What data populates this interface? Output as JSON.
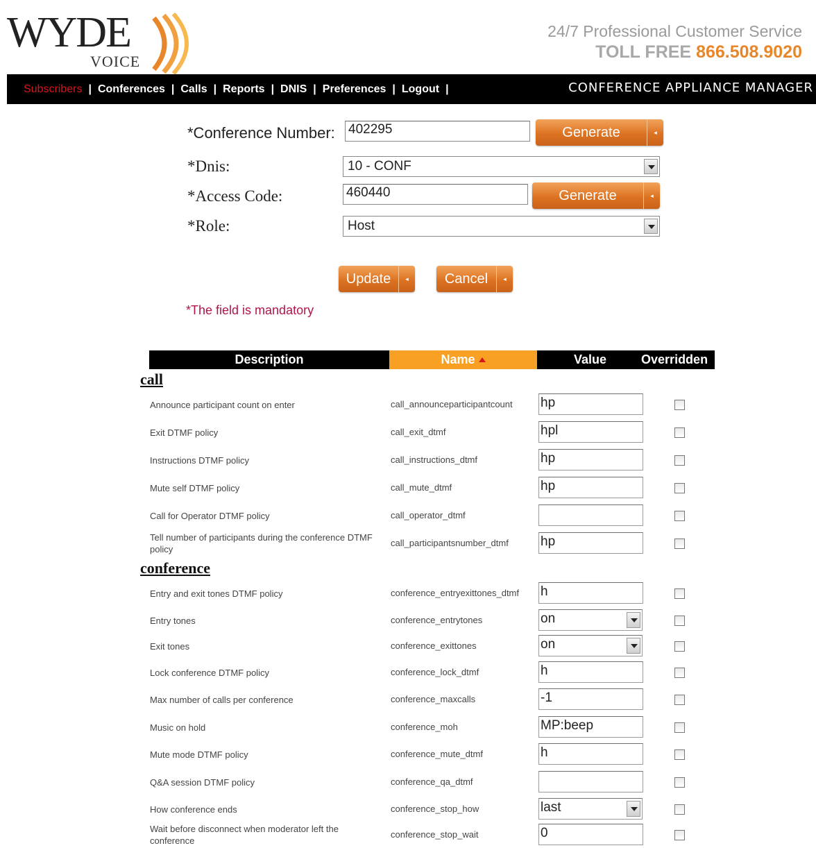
{
  "header": {
    "logo_word": "WYDE",
    "logo_sub": "VOICE",
    "service_line": "24/7 Professional Customer Service",
    "tollfree_label": "TOLL  FREE",
    "phone": "866.508.9020"
  },
  "nav": {
    "items": [
      {
        "label": "Subscribers"
      },
      {
        "label": "Conferences"
      },
      {
        "label": "Calls"
      },
      {
        "label": "Reports"
      },
      {
        "label": "DNIS"
      },
      {
        "label": "Preferences"
      },
      {
        "label": "Logout"
      }
    ],
    "separator": "|",
    "app_title": "CONFERENCE APPLIANCE MANAGER"
  },
  "form": {
    "conference_number": {
      "label": "*Conference Number:",
      "value": "402295"
    },
    "dnis": {
      "label": "*Dnis:",
      "value": "10 - CONF"
    },
    "access_code": {
      "label": "*Access Code:",
      "value": "460440"
    },
    "role": {
      "label": "*Role:",
      "value": "Host"
    },
    "generate_label": "Generate",
    "update_label": "Update",
    "cancel_label": "Cancel",
    "mandatory_note": "*The field is mandatory"
  },
  "table": {
    "headers": {
      "description": "Description",
      "name": "Name",
      "value": "Value",
      "overridden": "Overridden"
    },
    "sections": [
      {
        "title": "call",
        "rows": [
          {
            "desc": "Announce participant count on enter",
            "name": "call_announceparticipantcount",
            "type": "text",
            "value": "hp"
          },
          {
            "desc": "Exit DTMF policy",
            "name": "call_exit_dtmf",
            "type": "text",
            "value": "hpl"
          },
          {
            "desc": "Instructions DTMF policy",
            "name": "call_instructions_dtmf",
            "type": "text",
            "value": "hp"
          },
          {
            "desc": "Mute self DTMF policy",
            "name": "call_mute_dtmf",
            "type": "text",
            "value": "hp"
          },
          {
            "desc": "Call for Operator DTMF policy",
            "name": "call_operator_dtmf",
            "type": "text",
            "value": ""
          },
          {
            "desc": "Tell number of participants during the conference DTMF policy",
            "name": "call_participantsnumber_dtmf",
            "type": "text",
            "value": "hp"
          }
        ]
      },
      {
        "title": "conference",
        "rows": [
          {
            "desc": "Entry and exit tones DTMF policy",
            "name": "conference_entryexittones_dtmf",
            "type": "text",
            "value": "h"
          },
          {
            "desc": "Entry tones",
            "name": "conference_entrytones",
            "type": "select",
            "value": "on"
          },
          {
            "desc": "Exit tones",
            "name": "conference_exittones",
            "type": "select",
            "value": "on"
          },
          {
            "desc": "Lock conference DTMF policy",
            "name": "conference_lock_dtmf",
            "type": "text",
            "value": "h"
          },
          {
            "desc": "Max number of calls per conference",
            "name": "conference_maxcalls",
            "type": "text",
            "value": "-1"
          },
          {
            "desc": "Music on hold",
            "name": "conference_moh",
            "type": "text",
            "value": "MP:beep"
          },
          {
            "desc": "Mute mode DTMF policy",
            "name": "conference_mute_dtmf",
            "type": "text",
            "value": "h"
          },
          {
            "desc": "Q&A session DTMF policy",
            "name": "conference_qa_dtmf",
            "type": "text",
            "value": ""
          },
          {
            "desc": "How conference ends",
            "name": "conference_stop_how",
            "type": "select",
            "value": "last"
          },
          {
            "desc": "Wait before disconnect when moderator left the conference",
            "name": "conference_stop_wait",
            "type": "text",
            "value": "0"
          }
        ]
      }
    ]
  },
  "colors": {
    "accent": "#e8862a",
    "nav_active": "#d5151b",
    "name_header": "#f7a024",
    "mandatory": "#b0154a"
  },
  "icons": [
    "wyde-logo-arcs",
    "sort-ascending-icon",
    "dropdown-arrow-icon",
    "checkbox-icon"
  ]
}
